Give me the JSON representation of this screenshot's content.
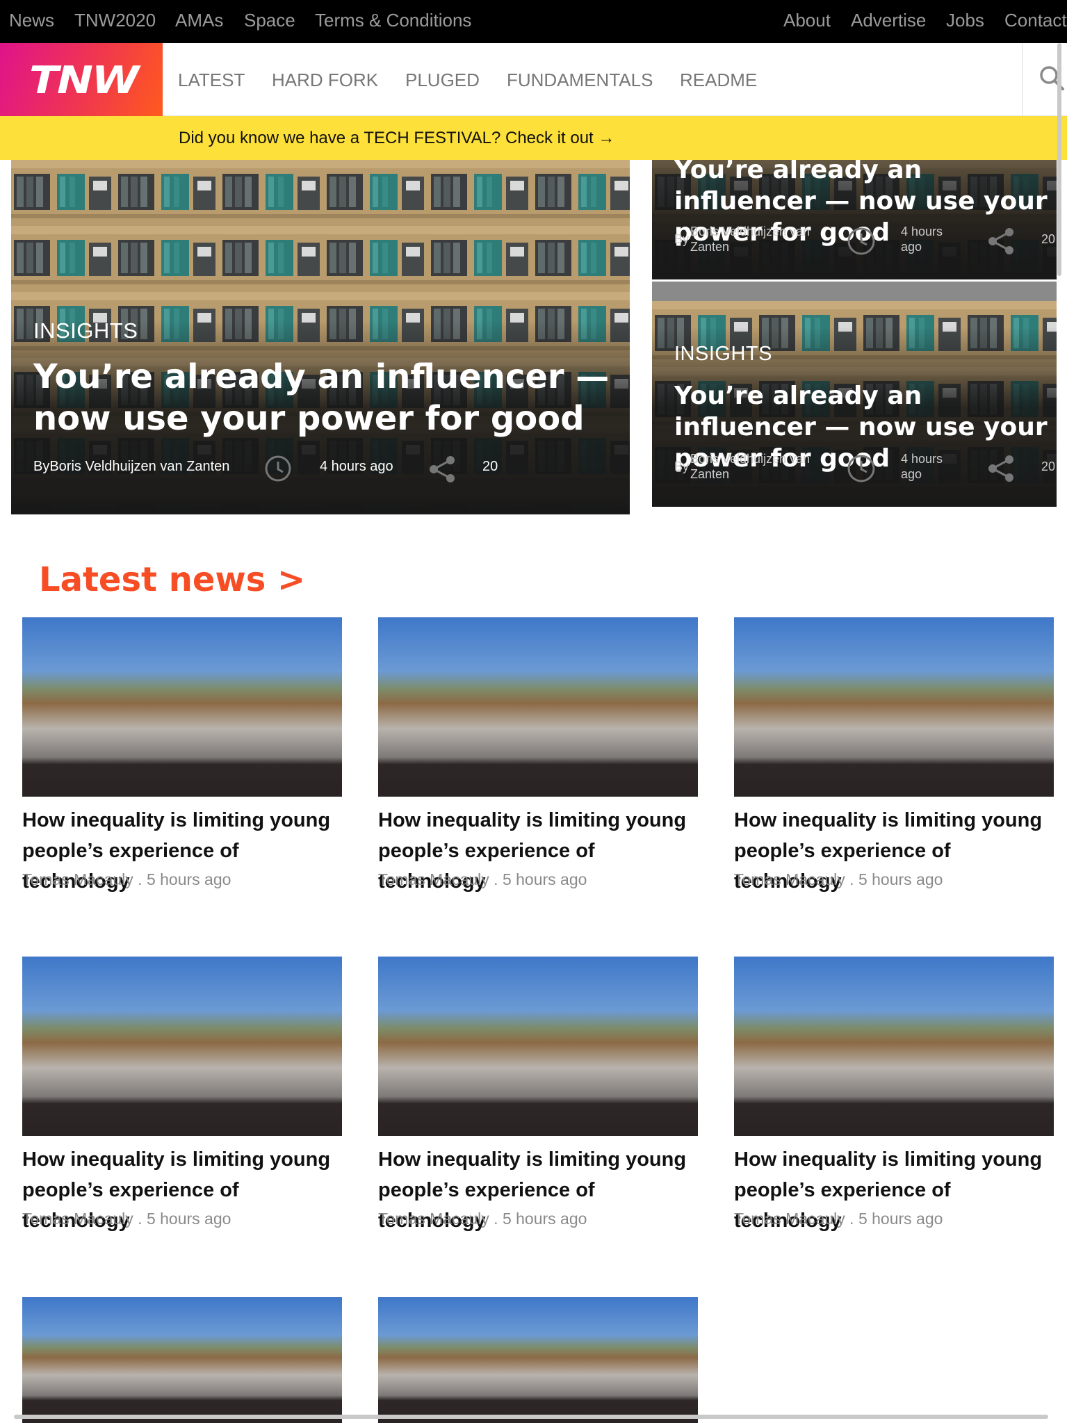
{
  "topbar": {
    "left_links": [
      "News",
      "TNW2020",
      "AMAs",
      "Space",
      "Terms & Conditions"
    ],
    "right_links": [
      "About",
      "Advertise",
      "Jobs",
      "Contact"
    ]
  },
  "mainnav": {
    "logo_text": "TNW",
    "links": [
      "LATEST",
      "HARD FORK",
      "PLUGED",
      "FUNDAMENTALS",
      "README"
    ],
    "search_icon": "search-icon"
  },
  "banner": {
    "text": "Did you know we have a TECH FESTIVAL? Check it out →"
  },
  "hero_main": {
    "category": "INSIGHTS",
    "title": "You’re already an influencer — now use your power for good",
    "byline": "ByBoris Veldhuijzen van Zanten",
    "time": "4 hours ago",
    "shares": "20"
  },
  "hero_side": [
    {
      "title": "You’re already an influencer — now use your power for good",
      "by": "By",
      "author": "Boris Veldhuijzen van Zanten",
      "time": "4 hours ago",
      "shares": "20"
    },
    {
      "category": "INSIGHTS",
      "title": "You’re already an influencer — now use your power for good",
      "by": "By",
      "author": "Boris Veldhuijzen van Zanten",
      "time": "4 hours ago",
      "shares": "20"
    }
  ],
  "latest": {
    "heading": "Latest news >",
    "articles": [
      {
        "headline": "How inequality is limiting young people’s experience of technology",
        "author": "Tomas Macauly . 5 hours ago"
      },
      {
        "headline": "How inequality is limiting young people’s experience of technology",
        "author": "Tomas Macauly . 5 hours ago"
      },
      {
        "headline": "How inequality is limiting young people’s experience of technology",
        "author": "Tomas Macauly . 5 hours ago"
      },
      {
        "headline": "How inequality is limiting young people’s experience of technology",
        "author": "Tomas Macauly . 5 hours ago"
      },
      {
        "headline": "How inequality is limiting young people’s experience of technology",
        "author": "Tomas Macauly . 5 hours ago"
      },
      {
        "headline": "How inequality is limiting young people’s experience of technology",
        "author": "Tomas Macauly . 5 hours ago"
      }
    ]
  },
  "colors": {
    "accent": "#f64d25",
    "banner": "#fde03a",
    "topbar": "#000000",
    "logo_gradient": [
      "#e0138b",
      "#ff5a1e"
    ]
  }
}
